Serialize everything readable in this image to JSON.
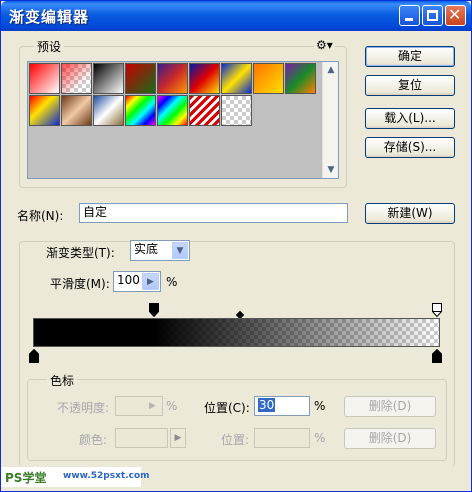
{
  "window": {
    "title": "渐变编辑器"
  },
  "presets": {
    "label": "预设",
    "swatches": [
      {
        "name": "red-to-transparent",
        "css": "linear-gradient(135deg,#ff0000,#ff9a9a 60%,#ffffff)"
      },
      {
        "name": "red-checker",
        "css": "linear-gradient(135deg,#f7c8c8,#ffffff)"
      },
      {
        "name": "black-to-white",
        "css": "linear-gradient(135deg,#000,#fff)"
      },
      {
        "name": "red-green",
        "css": "linear-gradient(135deg,#c40000,#196b18)"
      },
      {
        "name": "violet-orange",
        "css": "linear-gradient(135deg,#3a1b8a,#c9292a,#ff9a00)"
      },
      {
        "name": "blue-red-yellow",
        "css": "linear-gradient(135deg,#0018a8,#e00000,#ffe000)"
      },
      {
        "name": "blue-yellow-blue",
        "css": "linear-gradient(135deg,#0a2ad4,#ffe200 50%,#0a2ad4)"
      },
      {
        "name": "orange-yellow",
        "css": "linear-gradient(135deg,#ff7200,#ffe000)"
      },
      {
        "name": "violet-green-orange",
        "css": "linear-gradient(135deg,#7d1ba8,#178a2a,#ff8000)"
      },
      {
        "name": "stripes-red-blue",
        "css": "linear-gradient(135deg,#ff0000,#ffe200 40%,#0a2ad4)"
      },
      {
        "name": "copper",
        "css": "linear-gradient(135deg,#6d3a16,#f1c9a5 50%,#6d3a16)"
      },
      {
        "name": "chrome",
        "css": "linear-gradient(135deg,#1e4d9e,#ffffff 50%,#8b6a3a)"
      },
      {
        "name": "spectrum",
        "css": "linear-gradient(135deg,#ff0000,#ffff00,#00ff00,#00ffff,#0000ff,#ff00ff)"
      },
      {
        "name": "rainbow",
        "css": "linear-gradient(135deg,#ff00ff,#0000ff,#00ffff,#00ff00,#ffff00,#ff0000)"
      },
      {
        "name": "red-stripes",
        "css": "repeating-linear-gradient(135deg,#d50000 0 3px,#ffffff 3px 6px)"
      },
      {
        "name": "transparent-stripes",
        "css": "linear-gradient(135deg,#e0e0e0,#ffffff)"
      }
    ],
    "settings_icon": "gear-icon"
  },
  "buttons": {
    "ok": "确定",
    "reset": "复位",
    "load": "载入(L)...",
    "save": "存储(S)...",
    "new": "新建(W)",
    "delete_opacity": "删除(D)",
    "delete_color": "删除(D)"
  },
  "name_field": {
    "label": "名称(N):",
    "value": "自定"
  },
  "gradient_type": {
    "label": "渐变类型(T):",
    "value": "实底"
  },
  "smoothness": {
    "label": "平滑度(M):",
    "value": "100",
    "unit": "%"
  },
  "color_stops": {
    "label": "色标",
    "opacity_label": "不透明度:",
    "opacity_unit": "%",
    "position_label": "位置(C):",
    "position_value": "30",
    "position_unit": "%",
    "color_label": "颜色:",
    "color_position_label": "位置:",
    "color_position_unit": "%"
  },
  "watermark": {
    "left": "PS学堂",
    "right": "www.52psxt.com"
  }
}
